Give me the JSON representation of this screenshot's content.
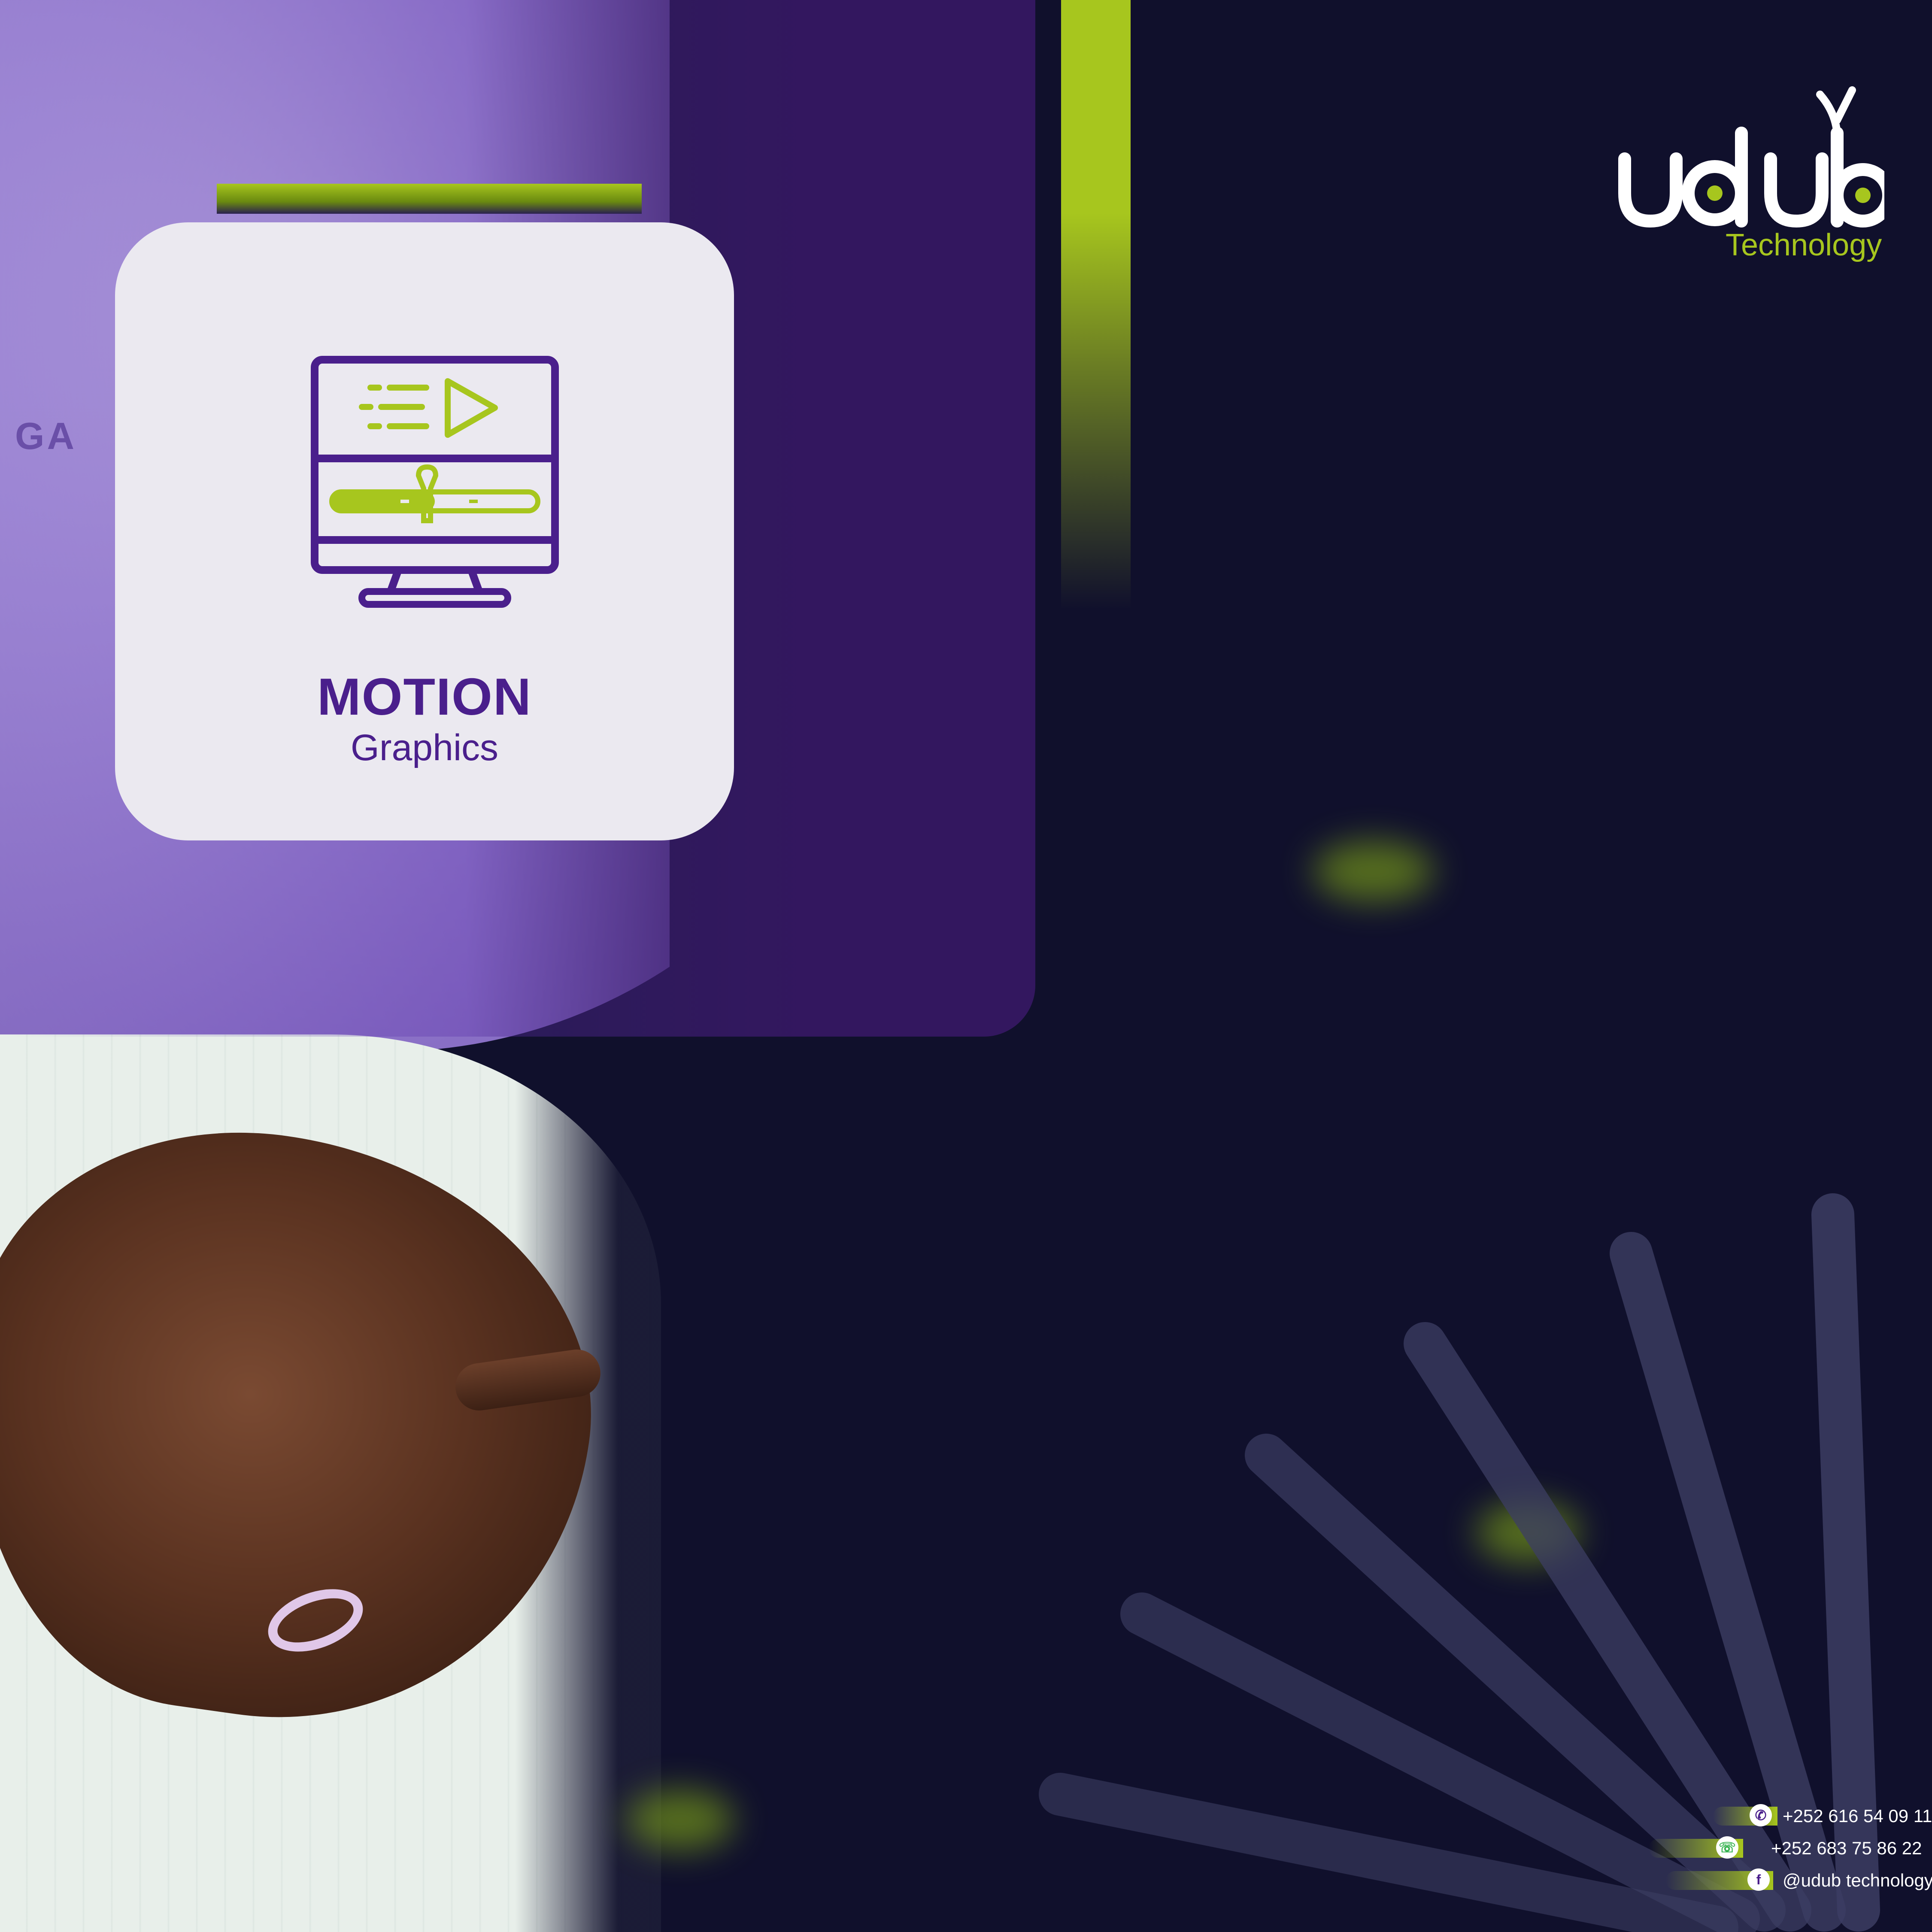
{
  "brand": {
    "logo_word": "udub",
    "logo_sub": "Technology",
    "ghost_text": "GA"
  },
  "card": {
    "title": "MOTION",
    "subtitle": "Graphics",
    "icon": "motion-graphics-monitor-icon"
  },
  "contacts": [
    {
      "icon": "viber-icon",
      "text": "+252 616 54 09 11"
    },
    {
      "icon": "whatsapp-icon",
      "text": "+252 683 75 86 22"
    },
    {
      "icon": "facebook-icon",
      "text": "@udub technology"
    }
  ],
  "colors": {
    "background": "#10102c",
    "accent_green": "#a7c61e",
    "accent_purple": "#4a1f8c",
    "panel_purple": "#33175f",
    "card_bg": "#ebe9f0"
  }
}
